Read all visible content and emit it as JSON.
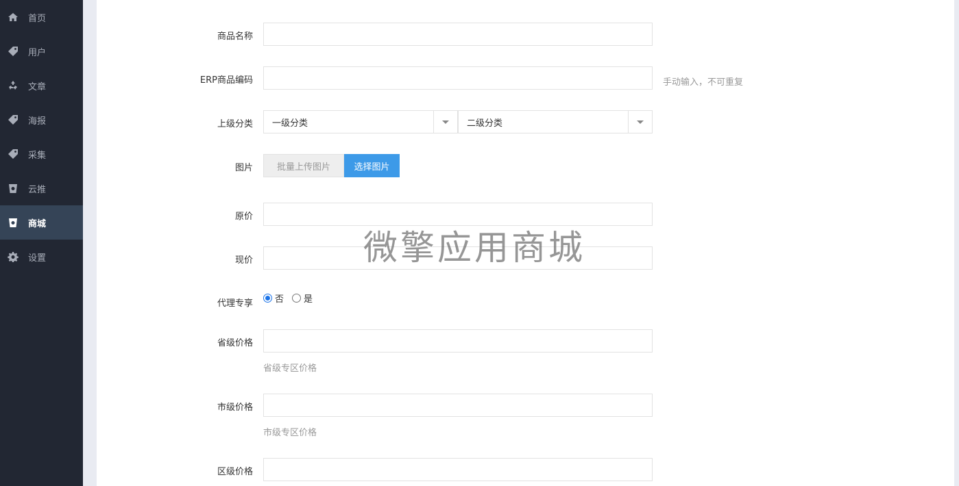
{
  "sidebar": {
    "items": [
      {
        "label": "首页",
        "icon": "home-icon"
      },
      {
        "label": "用户",
        "icon": "tag-icon"
      },
      {
        "label": "文章",
        "icon": "recycle-icon"
      },
      {
        "label": "海报",
        "icon": "tag-icon"
      },
      {
        "label": "采集",
        "icon": "tag-icon"
      },
      {
        "label": "云推",
        "icon": "cup-icon"
      },
      {
        "label": "商城",
        "icon": "cup-icon",
        "active": true
      },
      {
        "label": "设置",
        "icon": "gear-icon"
      }
    ]
  },
  "form": {
    "name_label": "商品名称",
    "erp_label": "ERP商品编码",
    "erp_hint": "手动输入，不可重复",
    "category_label": "上级分类",
    "category_level1": "一级分类",
    "category_level2": "二级分类",
    "image_label": "图片",
    "image_batch_placeholder": "批量上传图片",
    "image_select_button": "选择图片",
    "original_price_label": "原价",
    "current_price_label": "现价",
    "agent_label": "代理专享",
    "agent_no": "否",
    "agent_yes": "是",
    "province_price_label": "省级价格",
    "province_price_hint": "省级专区价格",
    "city_price_label": "市级价格",
    "city_price_hint": "市级专区价格",
    "district_price_label": "区级价格"
  },
  "watermark": "微擎应用商城",
  "colors": {
    "sidebar_bg": "#222733",
    "sidebar_active": "#354457",
    "accent": "#3d9ae8"
  }
}
